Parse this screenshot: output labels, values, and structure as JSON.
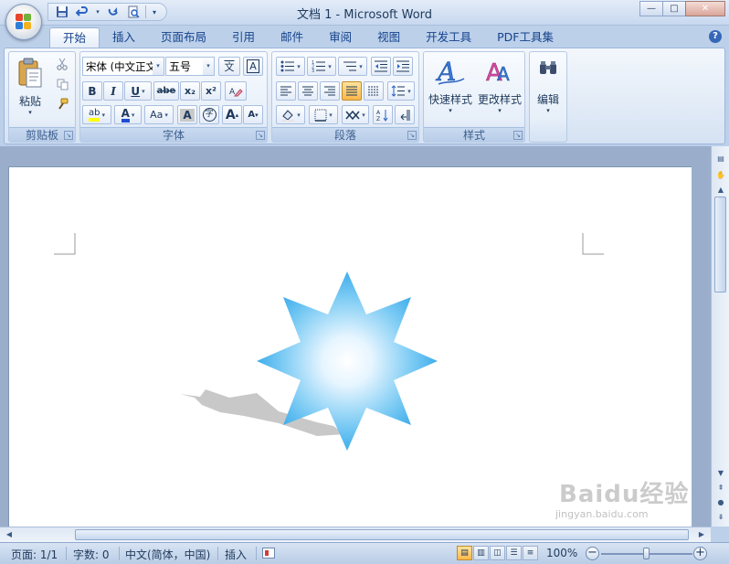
{
  "window": {
    "title": "文档 1 - Microsoft Word",
    "minimize_label": "—",
    "maximize_label": "□",
    "close_label": "✕"
  },
  "quick_access": {
    "save_icon": "save-icon",
    "undo_icon": "undo-icon",
    "redo_icon": "redo-icon",
    "print_preview_icon": "print-preview-icon"
  },
  "ribbon_tabs": [
    "开始",
    "插入",
    "页面布局",
    "引用",
    "邮件",
    "审阅",
    "视图",
    "开发工具",
    "PDF工具集"
  ],
  "help_label": "?",
  "clipboard": {
    "paste_label": "粘贴",
    "group_label": "剪贴板"
  },
  "font": {
    "font_name": "宋体 (中文正文)",
    "font_size": "五号",
    "bold": "B",
    "italic": "I",
    "underline": "U",
    "strike": "abe",
    "subscript": "x₂",
    "superscript": "x²",
    "grow": "A",
    "shrink": "A",
    "case": "Aa",
    "char_shading": "A",
    "phonetic": "文",
    "border_char": "A",
    "enclose": "字",
    "group_label": "字体"
  },
  "paragraph": {
    "group_label": "段落"
  },
  "styles": {
    "quick_styles_label": "快速样式",
    "change_styles_label": "更改样式",
    "group_label": "样式"
  },
  "editing": {
    "label": "编辑"
  },
  "statusbar": {
    "page": "页面: 1/1",
    "words": "字数: 0",
    "language": "中文(简体，中国)",
    "mode": "插入",
    "zoom": "100%",
    "zoom_level": 0.5
  },
  "watermark": {
    "text": "Baidu经验",
    "sub": "jingyan.baidu.com"
  },
  "colors": {
    "star_center": "#ffffff",
    "star_edge": "#2aa3e8",
    "shadow": "#c8c8c8",
    "highlight": "#ffff00",
    "font_color": "#1f4bd2"
  }
}
